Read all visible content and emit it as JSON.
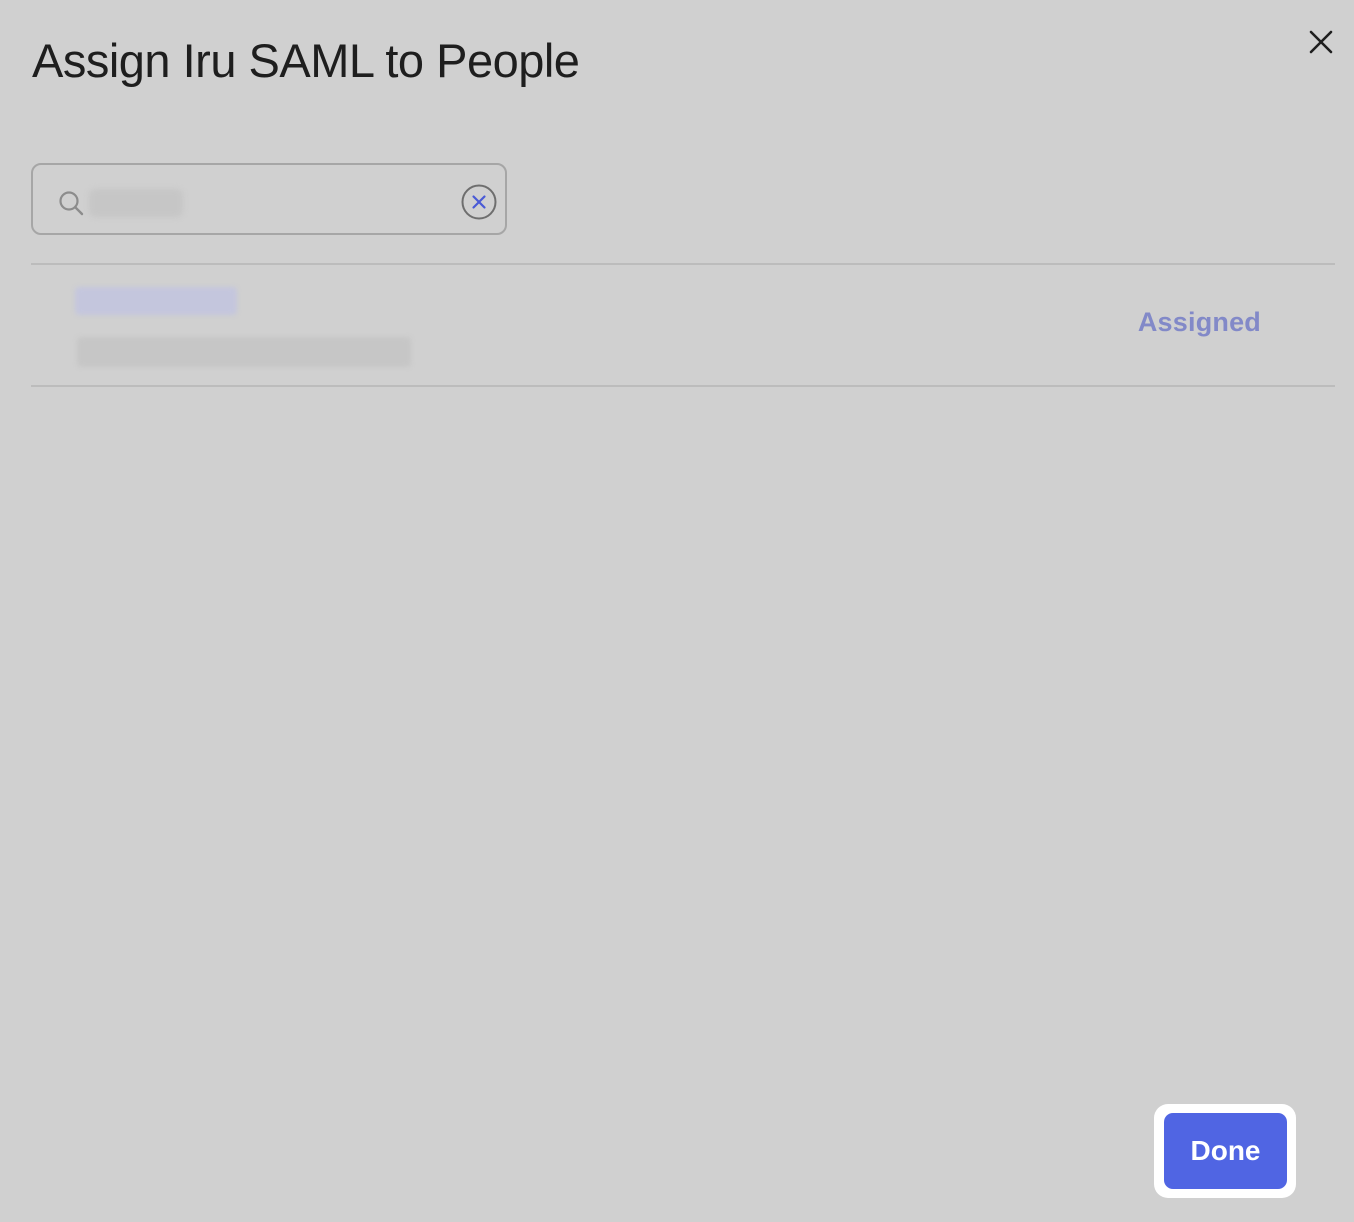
{
  "dialog": {
    "title": "Assign Iru SAML to People",
    "close_icon": "close-icon"
  },
  "search": {
    "placeholder": "",
    "value": "",
    "search_icon": "search-icon",
    "clear_icon": "clear-circle-icon"
  },
  "results": [
    {
      "name": "",
      "email": "",
      "status": "Assigned"
    }
  ],
  "footer": {
    "done_label": "Done"
  },
  "colors": {
    "background": "#d0d0d0",
    "accent": "#5065e3",
    "status_text": "#8289c8"
  }
}
